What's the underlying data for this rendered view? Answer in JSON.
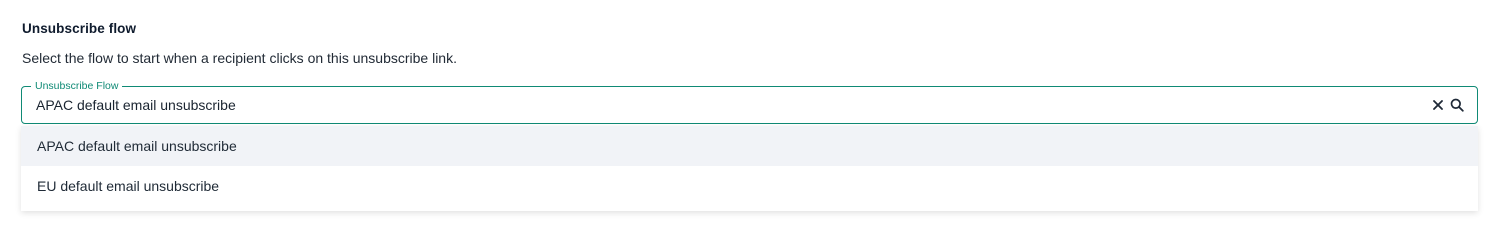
{
  "section": {
    "title": "Unsubscribe flow",
    "description": "Select the flow to start when a recipient clicks on this unsubscribe link."
  },
  "field": {
    "label": "Unsubscribe Flow",
    "value": "APAC default email unsubscribe",
    "accent_color": "#0f8a75",
    "clear_icon": "close-icon",
    "search_icon": "search-icon"
  },
  "dropdown": {
    "options": [
      {
        "label": "APAC default email unsubscribe",
        "highlighted": true
      },
      {
        "label": "EU default email unsubscribe",
        "highlighted": false
      }
    ]
  }
}
